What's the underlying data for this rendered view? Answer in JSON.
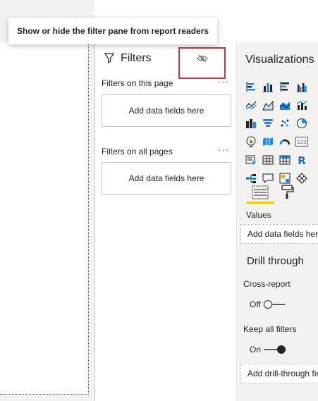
{
  "tooltip": {
    "text": "Show or hide the filter pane from report readers"
  },
  "filters": {
    "title": "Filters",
    "icons": {
      "filter": "filter-funnel-icon",
      "visibility": "eye-slash-icon",
      "collapse": "chevron-right-icon"
    },
    "highlight_color": "#d13438",
    "sections": [
      {
        "label": "Filters on this page",
        "drop_text": "Add data fields here"
      },
      {
        "label": "Filters on all pages",
        "drop_text": "Add data fields here"
      }
    ]
  },
  "visualizations": {
    "title": "Visualizations",
    "icons": [
      "stacked-bar-icon",
      "stacked-column-icon",
      "clustered-bar-icon",
      "clustered-column-icon",
      "line-chart-icon",
      "area-chart-icon",
      "stacked-area-icon",
      "line-column-icon",
      "ribbon-chart-icon",
      "funnel-waterfall-icon",
      "scatter-chart-icon",
      "pie-chart-icon",
      "map-icon",
      "filled-map-icon",
      "gauge-icon",
      "card-icon",
      "slicer-icon",
      "table-icon",
      "matrix-icon",
      "r-visual-icon",
      "decomposition-tree-icon",
      "qa-icon",
      "key-influencers-icon",
      "more-visuals-icon"
    ],
    "tabs": {
      "fields_icon": "fields-icon",
      "format_icon": "paint-roller-icon",
      "active_color": "#f2c811"
    },
    "values_label": "Values",
    "values_drop": "Add data fields here",
    "drill": {
      "title": "Drill through",
      "cross_report": {
        "label": "Cross-report",
        "state": "Off"
      },
      "keep_filters": {
        "label": "Keep all filters",
        "state": "On"
      },
      "drop": "Add drill-through fields here"
    }
  }
}
